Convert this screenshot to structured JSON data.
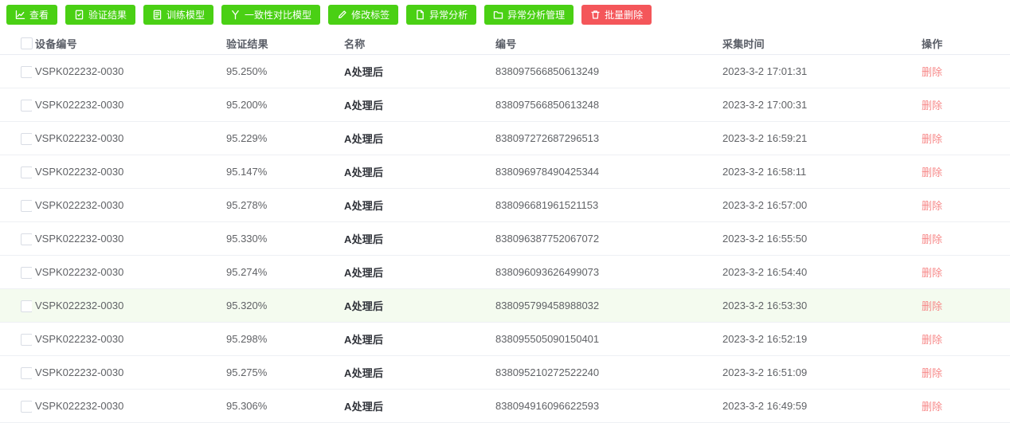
{
  "toolbar": {
    "buttons": [
      {
        "label": "查看",
        "icon": "line-chart-icon",
        "type": "success"
      },
      {
        "label": "验证结果",
        "icon": "report-check-icon",
        "type": "success"
      },
      {
        "label": "训练模型",
        "icon": "document-lines-icon",
        "type": "success"
      },
      {
        "label": "一致性对比模型",
        "icon": "branch-icon",
        "type": "success"
      },
      {
        "label": "修改标签",
        "icon": "edit-pencil-icon",
        "type": "success"
      },
      {
        "label": "异常分析",
        "icon": "file-icon",
        "type": "success"
      },
      {
        "label": "异常分析管理",
        "icon": "folder-icon",
        "type": "success"
      },
      {
        "label": "批量删除",
        "icon": "trash-icon",
        "type": "danger"
      }
    ]
  },
  "table": {
    "columns": [
      "设备编号",
      "验证结果",
      "名称",
      "编号",
      "采集时间",
      "操作"
    ],
    "delete_label": "删除",
    "highlighted_row_index": 7,
    "rows": [
      {
        "device": "VSPK022232-0030",
        "result": "95.250%",
        "name": "A处理后",
        "code": "838097566850613249",
        "time": "2023-3-2 17:01:31"
      },
      {
        "device": "VSPK022232-0030",
        "result": "95.200%",
        "name": "A处理后",
        "code": "838097566850613248",
        "time": "2023-3-2 17:00:31"
      },
      {
        "device": "VSPK022232-0030",
        "result": "95.229%",
        "name": "A处理后",
        "code": "838097272687296513",
        "time": "2023-3-2 16:59:21"
      },
      {
        "device": "VSPK022232-0030",
        "result": "95.147%",
        "name": "A处理后",
        "code": "838096978490425344",
        "time": "2023-3-2 16:58:11"
      },
      {
        "device": "VSPK022232-0030",
        "result": "95.278%",
        "name": "A处理后",
        "code": "838096681961521153",
        "time": "2023-3-2 16:57:00"
      },
      {
        "device": "VSPK022232-0030",
        "result": "95.330%",
        "name": "A处理后",
        "code": "838096387752067072",
        "time": "2023-3-2 16:55:50"
      },
      {
        "device": "VSPK022232-0030",
        "result": "95.274%",
        "name": "A处理后",
        "code": "838096093626499073",
        "time": "2023-3-2 16:54:40"
      },
      {
        "device": "VSPK022232-0030",
        "result": "95.320%",
        "name": "A处理后",
        "code": "838095799458988032",
        "time": "2023-3-2 16:53:30"
      },
      {
        "device": "VSPK022232-0030",
        "result": "95.298%",
        "name": "A处理后",
        "code": "838095505090150401",
        "time": "2023-3-2 16:52:19"
      },
      {
        "device": "VSPK022232-0030",
        "result": "95.275%",
        "name": "A处理后",
        "code": "838095210272522240",
        "time": "2023-3-2 16:51:09"
      },
      {
        "device": "VSPK022232-0030",
        "result": "95.306%",
        "name": "A处理后",
        "code": "838094916096622593",
        "time": "2023-3-2 16:49:59"
      }
    ]
  },
  "colors": {
    "button_green": "#4ad014",
    "button_red": "#f4565a",
    "delete_link_red": "#f78989",
    "row_highlight": "#f4fbef",
    "cell_text": "#606266",
    "name_text": "#2e3138"
  }
}
